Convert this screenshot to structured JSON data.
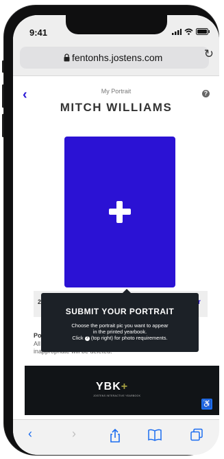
{
  "status_bar": {
    "time": "9:41"
  },
  "browser": {
    "url": "fentonhs.jostens.com"
  },
  "page": {
    "breadcrumb": "My Portrait",
    "name": "MITCH WILLIAMS",
    "row_left_text": "2",
    "row_right_text": "r",
    "note_title": "Po",
    "note_line1": "All",
    "note_line2": "inappropriate will be deleted."
  },
  "tooltip": {
    "title": "SUBMIT YOUR PORTRAIT",
    "line1": "Choose the portrait pic you want to appear",
    "line2": "in the printed yearbook.",
    "line3_pre": "Click",
    "line3_post": "(top right) for photo requirements."
  },
  "footer": {
    "logo": "YBK",
    "logo_plus": "+",
    "logo_sub": "JOSTENS INTERACTIVE YEARBOOK"
  },
  "colors": {
    "accent": "#2b12d4",
    "tooltip_bg": "#1c2127",
    "ios_blue": "#1a6cf0"
  }
}
